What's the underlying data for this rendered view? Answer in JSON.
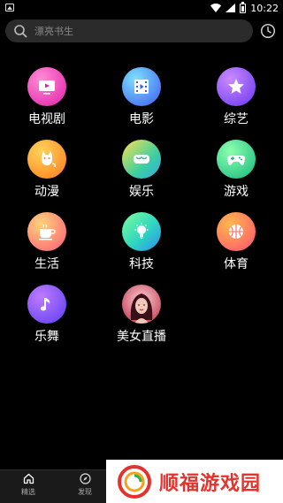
{
  "status_bar": {
    "time": "10:22"
  },
  "search": {
    "placeholder": "漂亮书生"
  },
  "categories": [
    {
      "label": "电视剧",
      "icon": "tv-icon"
    },
    {
      "label": "电影",
      "icon": "film-icon"
    },
    {
      "label": "综艺",
      "icon": "star-icon"
    },
    {
      "label": "动漫",
      "icon": "cat-icon"
    },
    {
      "label": "娱乐",
      "icon": "vr-glasses-icon"
    },
    {
      "label": "游戏",
      "icon": "gamepad-icon"
    },
    {
      "label": "生活",
      "icon": "coffee-cup-icon"
    },
    {
      "label": "科技",
      "icon": "lightbulb-icon"
    },
    {
      "label": "体育",
      "icon": "basketball-icon"
    },
    {
      "label": "乐舞",
      "icon": "music-note-icon"
    },
    {
      "label": "美女直播",
      "icon": "woman-avatar-icon"
    }
  ],
  "bottom_nav": {
    "items": [
      {
        "label": "精选",
        "icon": "home-icon"
      },
      {
        "label": "发现",
        "icon": "compass-icon"
      }
    ]
  },
  "watermark": {
    "text": "顺福游戏园"
  },
  "colors": {
    "background": "#000000",
    "search_bg": "#2b2b2b",
    "watermark_red": "#e5322d"
  }
}
